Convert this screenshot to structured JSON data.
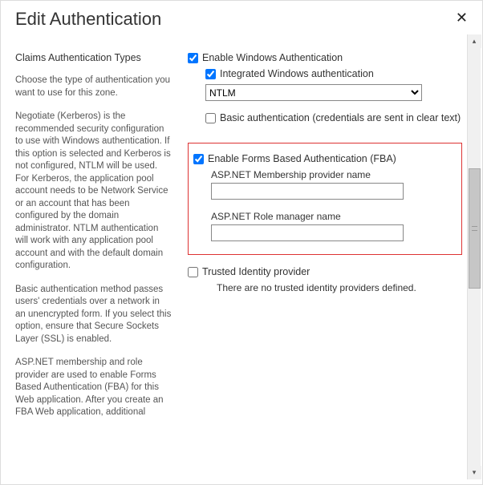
{
  "dialog": {
    "title": "Edit Authentication",
    "close": "✕"
  },
  "left": {
    "heading": "Claims Authentication Types",
    "p1": "Choose the type of authentication you want to use for this zone.",
    "p2": "Negotiate (Kerberos) is the recommended security configuration to use with Windows authentication. If this option is selected and Kerberos is not configured, NTLM will be used. For Kerberos, the application pool account needs to be Network Service or an account that has been configured by the domain administrator. NTLM authentication will work with any application pool account and with the default domain configuration.",
    "p3": "Basic authentication method passes users' credentials over a network in an unencrypted form. If you select this option, ensure that Secure Sockets Layer (SSL) is enabled.",
    "p4": "ASP.NET membership and role provider are used to enable Forms Based Authentication (FBA) for this Web application. After you create an FBA Web application, additional"
  },
  "right": {
    "enableWindows": "Enable Windows Authentication",
    "integrated": "Integrated Windows authentication",
    "ntlm": "NTLM",
    "basic": "Basic authentication (credentials are sent in clear text)",
    "enableFba": "Enable Forms Based Authentication (FBA)",
    "membershipLabel": "ASP.NET Membership provider name",
    "membershipValue": "",
    "roleLabel": "ASP.NET Role manager name",
    "roleValue": "",
    "trusted": "Trusted Identity provider",
    "trustedMsg": "There are no trusted identity providers defined."
  }
}
